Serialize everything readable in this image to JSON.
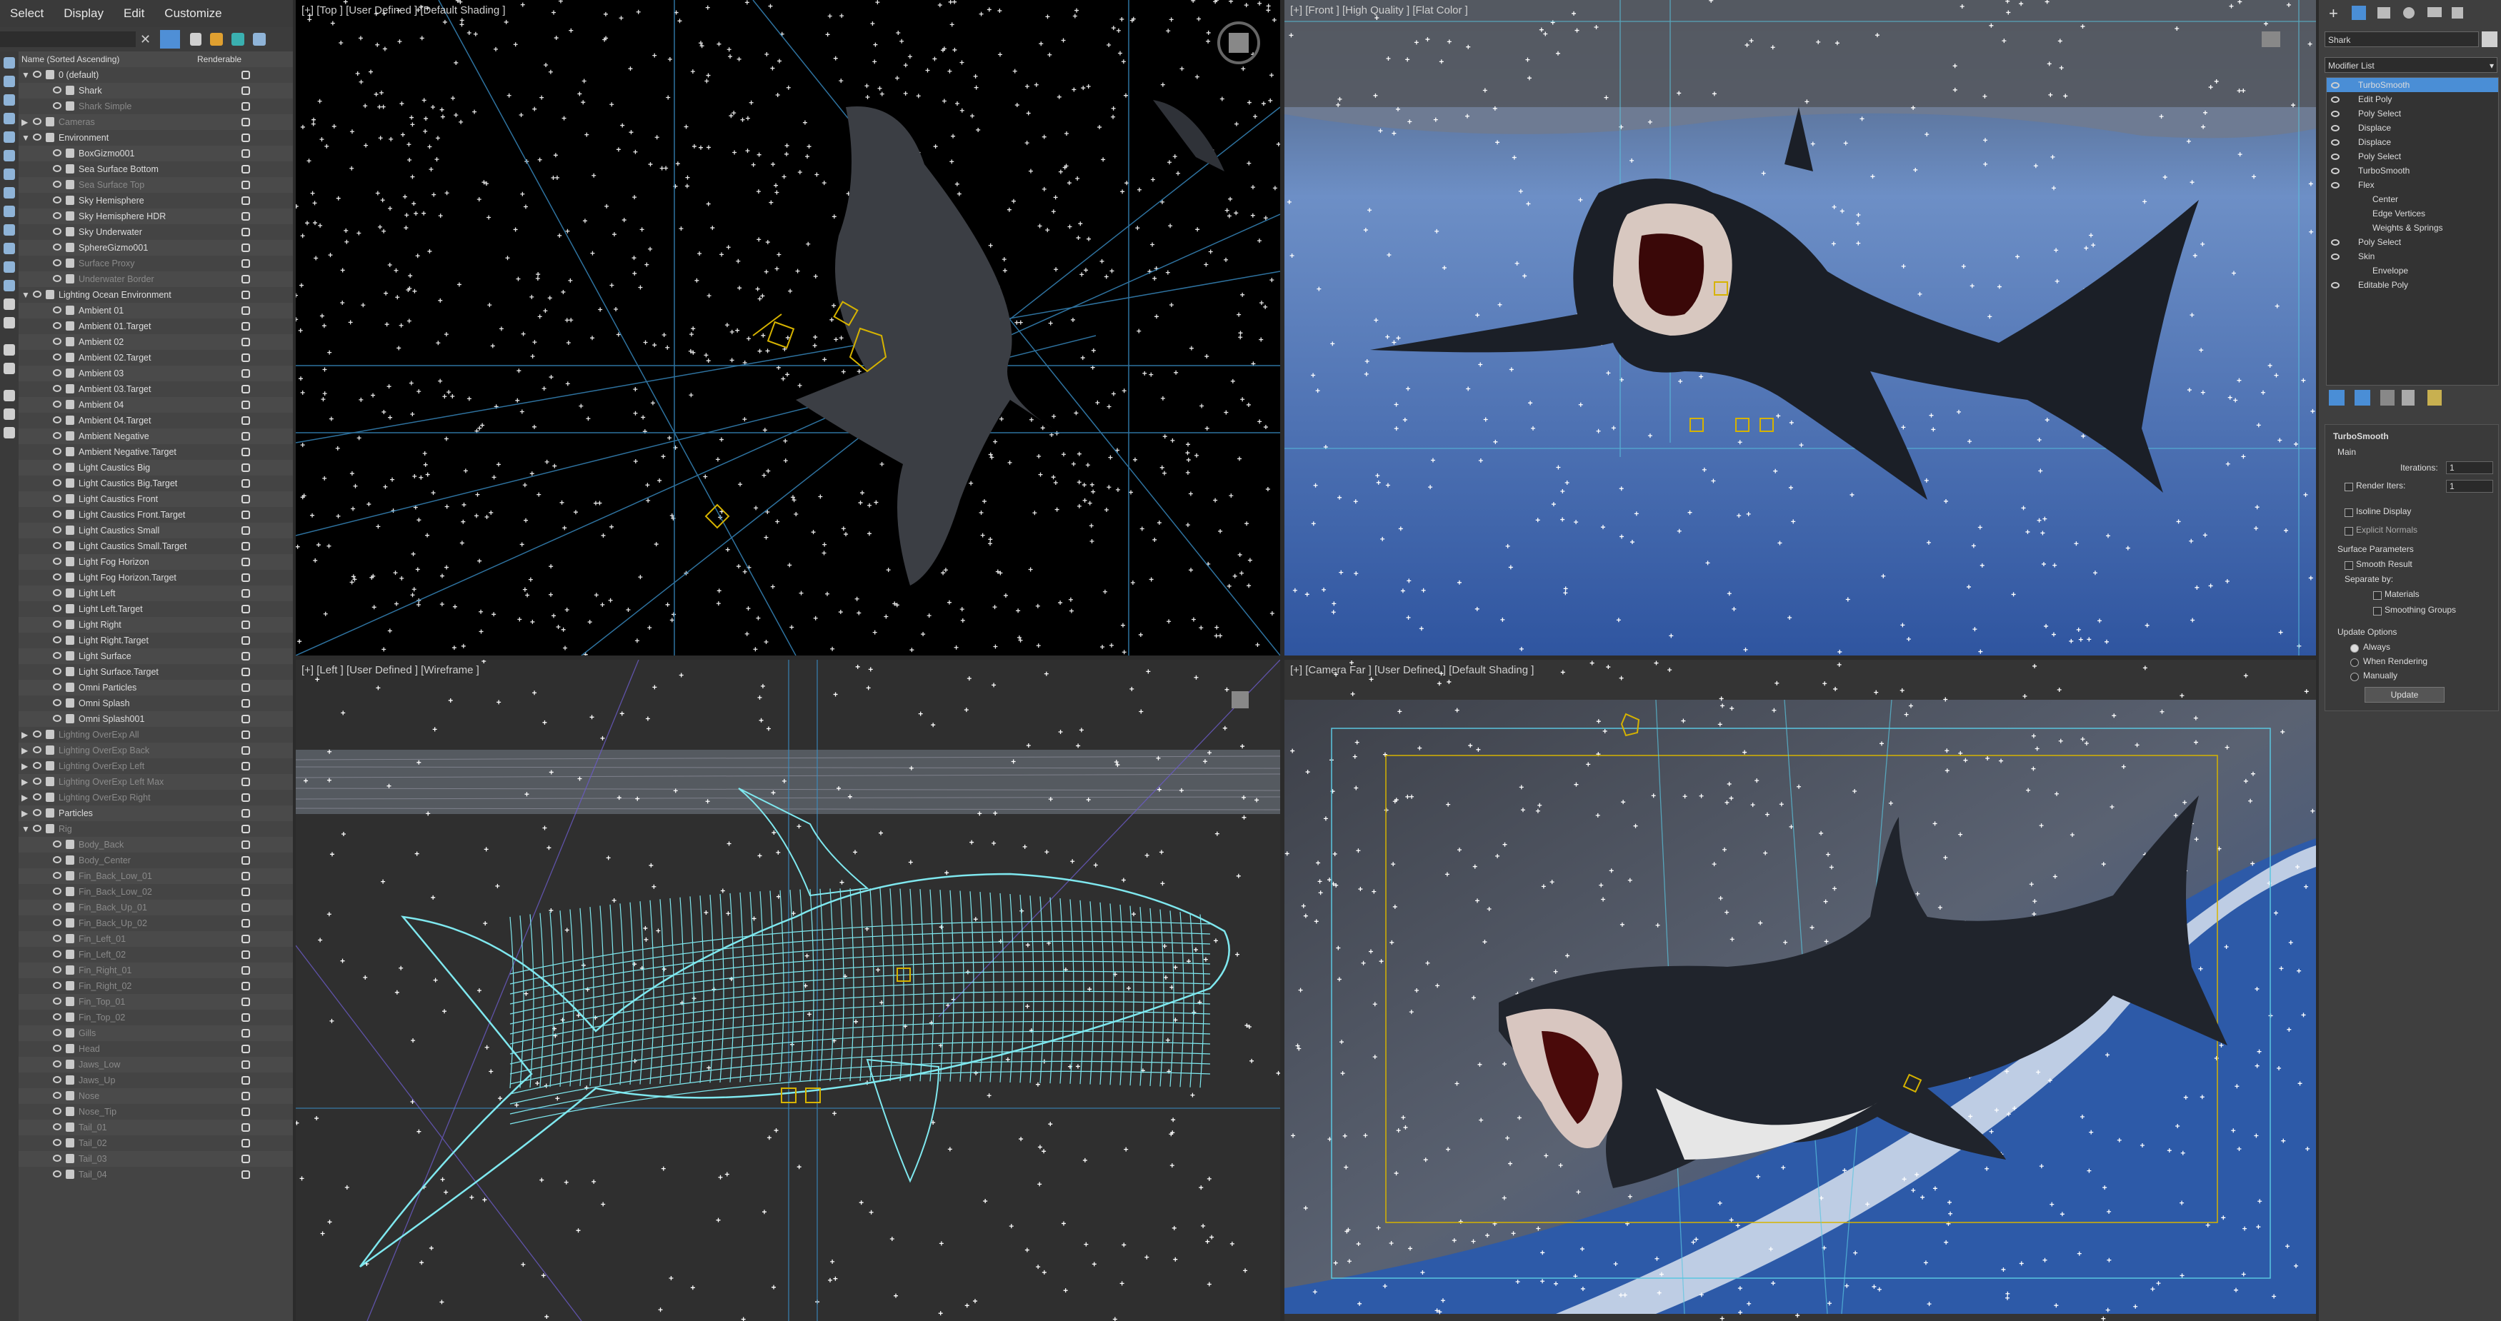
{
  "menu": [
    "Select",
    "Display",
    "Edit",
    "Customize"
  ],
  "explorer": {
    "col_name": "Name (Sorted Ascending)",
    "col_renderable": "Renderable",
    "rows": [
      {
        "label": "0 (default)",
        "indent": 0,
        "arrow": "▼",
        "dim": false
      },
      {
        "label": "Shark",
        "indent": 1,
        "arrow": "",
        "dim": false
      },
      {
        "label": "Shark Simple",
        "indent": 1,
        "arrow": "",
        "dim": true
      },
      {
        "label": "Cameras",
        "indent": 0,
        "arrow": "▶",
        "dim": true
      },
      {
        "label": "Environment",
        "indent": 0,
        "arrow": "▼",
        "dim": false
      },
      {
        "label": "BoxGizmo001",
        "indent": 1,
        "arrow": "",
        "dim": false
      },
      {
        "label": "Sea Surface Bottom",
        "indent": 1,
        "arrow": "",
        "dim": false
      },
      {
        "label": "Sea Surface Top",
        "indent": 1,
        "arrow": "",
        "dim": true
      },
      {
        "label": "Sky Hemisphere",
        "indent": 1,
        "arrow": "",
        "dim": false
      },
      {
        "label": "Sky Hemisphere HDR",
        "indent": 1,
        "arrow": "",
        "dim": false
      },
      {
        "label": "Sky Underwater",
        "indent": 1,
        "arrow": "",
        "dim": false
      },
      {
        "label": "SphereGizmo001",
        "indent": 1,
        "arrow": "",
        "dim": false
      },
      {
        "label": "Surface Proxy",
        "indent": 1,
        "arrow": "",
        "dim": true
      },
      {
        "label": "Underwater Border",
        "indent": 1,
        "arrow": "",
        "dim": true
      },
      {
        "label": "Lighting Ocean Environment",
        "indent": 0,
        "arrow": "▼",
        "dim": false
      },
      {
        "label": "Ambient 01",
        "indent": 1,
        "arrow": "",
        "dim": false
      },
      {
        "label": "Ambient 01.Target",
        "indent": 1,
        "arrow": "",
        "dim": false
      },
      {
        "label": "Ambient 02",
        "indent": 1,
        "arrow": "",
        "dim": false
      },
      {
        "label": "Ambient 02.Target",
        "indent": 1,
        "arrow": "",
        "dim": false
      },
      {
        "label": "Ambient 03",
        "indent": 1,
        "arrow": "",
        "dim": false
      },
      {
        "label": "Ambient 03.Target",
        "indent": 1,
        "arrow": "",
        "dim": false
      },
      {
        "label": "Ambient 04",
        "indent": 1,
        "arrow": "",
        "dim": false
      },
      {
        "label": "Ambient 04.Target",
        "indent": 1,
        "arrow": "",
        "dim": false
      },
      {
        "label": "Ambient Negative",
        "indent": 1,
        "arrow": "",
        "dim": false
      },
      {
        "label": "Ambient Negative.Target",
        "indent": 1,
        "arrow": "",
        "dim": false
      },
      {
        "label": "Light Caustics Big",
        "indent": 1,
        "arrow": "",
        "dim": false
      },
      {
        "label": "Light Caustics Big.Target",
        "indent": 1,
        "arrow": "",
        "dim": false
      },
      {
        "label": "Light Caustics Front",
        "indent": 1,
        "arrow": "",
        "dim": false
      },
      {
        "label": "Light Caustics Front.Target",
        "indent": 1,
        "arrow": "",
        "dim": false
      },
      {
        "label": "Light Caustics Small",
        "indent": 1,
        "arrow": "",
        "dim": false
      },
      {
        "label": "Light Caustics Small.Target",
        "indent": 1,
        "arrow": "",
        "dim": false
      },
      {
        "label": "Light Fog Horizon",
        "indent": 1,
        "arrow": "",
        "dim": false
      },
      {
        "label": "Light Fog Horizon.Target",
        "indent": 1,
        "arrow": "",
        "dim": false
      },
      {
        "label": "Light Left",
        "indent": 1,
        "arrow": "",
        "dim": false
      },
      {
        "label": "Light Left.Target",
        "indent": 1,
        "arrow": "",
        "dim": false
      },
      {
        "label": "Light Right",
        "indent": 1,
        "arrow": "",
        "dim": false
      },
      {
        "label": "Light Right.Target",
        "indent": 1,
        "arrow": "",
        "dim": false
      },
      {
        "label": "Light Surface",
        "indent": 1,
        "arrow": "",
        "dim": false
      },
      {
        "label": "Light Surface.Target",
        "indent": 1,
        "arrow": "",
        "dim": false
      },
      {
        "label": "Omni Particles",
        "indent": 1,
        "arrow": "",
        "dim": false
      },
      {
        "label": "Omni Splash",
        "indent": 1,
        "arrow": "",
        "dim": false
      },
      {
        "label": "Omni Splash001",
        "indent": 1,
        "arrow": "",
        "dim": false
      },
      {
        "label": "Lighting OverExp All",
        "indent": 0,
        "arrow": "▶",
        "dim": true
      },
      {
        "label": "Lighting OverExp Back",
        "indent": 0,
        "arrow": "▶",
        "dim": true
      },
      {
        "label": "Lighting OverExp Left",
        "indent": 0,
        "arrow": "▶",
        "dim": true
      },
      {
        "label": "Lighting OverExp Left Max",
        "indent": 0,
        "arrow": "▶",
        "dim": true
      },
      {
        "label": "Lighting OverExp Right",
        "indent": 0,
        "arrow": "▶",
        "dim": true
      },
      {
        "label": "Particles",
        "indent": 0,
        "arrow": "▶",
        "dim": false
      },
      {
        "label": "Rig",
        "indent": 0,
        "arrow": "▼",
        "dim": true
      },
      {
        "label": "Body_Back",
        "indent": 1,
        "arrow": "",
        "dim": true
      },
      {
        "label": "Body_Center",
        "indent": 1,
        "arrow": "",
        "dim": true
      },
      {
        "label": "Fin_Back_Low_01",
        "indent": 1,
        "arrow": "",
        "dim": true
      },
      {
        "label": "Fin_Back_Low_02",
        "indent": 1,
        "arrow": "",
        "dim": true
      },
      {
        "label": "Fin_Back_Up_01",
        "indent": 1,
        "arrow": "",
        "dim": true
      },
      {
        "label": "Fin_Back_Up_02",
        "indent": 1,
        "arrow": "",
        "dim": true
      },
      {
        "label": "Fin_Left_01",
        "indent": 1,
        "arrow": "",
        "dim": true
      },
      {
        "label": "Fin_Left_02",
        "indent": 1,
        "arrow": "",
        "dim": true
      },
      {
        "label": "Fin_Right_01",
        "indent": 1,
        "arrow": "",
        "dim": true
      },
      {
        "label": "Fin_Right_02",
        "indent": 1,
        "arrow": "",
        "dim": true
      },
      {
        "label": "Fin_Top_01",
        "indent": 1,
        "arrow": "",
        "dim": true
      },
      {
        "label": "Fin_Top_02",
        "indent": 1,
        "arrow": "",
        "dim": true
      },
      {
        "label": "Gills",
        "indent": 1,
        "arrow": "",
        "dim": true
      },
      {
        "label": "Head",
        "indent": 1,
        "arrow": "",
        "dim": true
      },
      {
        "label": "Jaws_Low",
        "indent": 1,
        "arrow": "",
        "dim": true
      },
      {
        "label": "Jaws_Up",
        "indent": 1,
        "arrow": "",
        "dim": true
      },
      {
        "label": "Nose",
        "indent": 1,
        "arrow": "",
        "dim": true
      },
      {
        "label": "Nose_Tip",
        "indent": 1,
        "arrow": "",
        "dim": true
      },
      {
        "label": "Tail_01",
        "indent": 1,
        "arrow": "",
        "dim": true
      },
      {
        "label": "Tail_02",
        "indent": 1,
        "arrow": "",
        "dim": true
      },
      {
        "label": "Tail_03",
        "indent": 1,
        "arrow": "",
        "dim": true
      },
      {
        "label": "Tail_04",
        "indent": 1,
        "arrow": "",
        "dim": true
      }
    ]
  },
  "viewports": {
    "top": "[+] [Top ] [User Defined ] [Default Shading ]",
    "front": "[+] [Front ] [High Quality ] [Flat Color ]",
    "left": "[+] [Left ] [User Defined ] [Wireframe ]",
    "camera": "[+] [Camera Far ] [User Defined ] [Default Shading ]"
  },
  "command_panel": {
    "object_name": "Shark",
    "modifier_list": "Modifier List",
    "stack": [
      {
        "label": "TurboSmooth",
        "indent": 0,
        "selected": true
      },
      {
        "label": "Edit Poly",
        "indent": 0,
        "selected": false
      },
      {
        "label": "Poly Select",
        "indent": 0,
        "selected": false
      },
      {
        "label": "Displace",
        "indent": 0,
        "selected": false
      },
      {
        "label": "Displace",
        "indent": 0,
        "selected": false
      },
      {
        "label": "Poly Select",
        "indent": 0,
        "selected": false
      },
      {
        "label": "TurboSmooth",
        "indent": 0,
        "selected": false
      },
      {
        "label": "Flex",
        "indent": 0,
        "selected": false
      },
      {
        "label": "Center",
        "indent": 1,
        "selected": false
      },
      {
        "label": "Edge Vertices",
        "indent": 1,
        "selected": false
      },
      {
        "label": "Weights & Springs",
        "indent": 1,
        "selected": false
      },
      {
        "label": "Poly Select",
        "indent": 0,
        "selected": false
      },
      {
        "label": "Skin",
        "indent": 0,
        "selected": false
      },
      {
        "label": "Envelope",
        "indent": 1,
        "selected": false
      },
      {
        "label": "Editable Poly",
        "indent": 0,
        "selected": false
      }
    ],
    "rollout_title": "TurboSmooth",
    "main_label": "Main",
    "iterations_label": "Iterations:",
    "iterations_value": "1",
    "render_iters_label": "Render Iters:",
    "render_iters_value": "1",
    "isoline_label": "Isoline Display",
    "explicit_normals_label": "Explicit Normals",
    "surface_params_label": "Surface Parameters",
    "smooth_result_label": "Smooth Result",
    "separate_by_label": "Separate by:",
    "materials_label": "Materials",
    "smoothing_groups_label": "Smoothing Groups",
    "update_options_label": "Update Options",
    "always_label": "Always",
    "when_rendering_label": "When Rendering",
    "manually_label": "Manually",
    "update_button": "Update"
  },
  "colors": {
    "wire": "#7fe8ef",
    "selection": "#4a8ed6",
    "gizmo": "#d6b300"
  }
}
